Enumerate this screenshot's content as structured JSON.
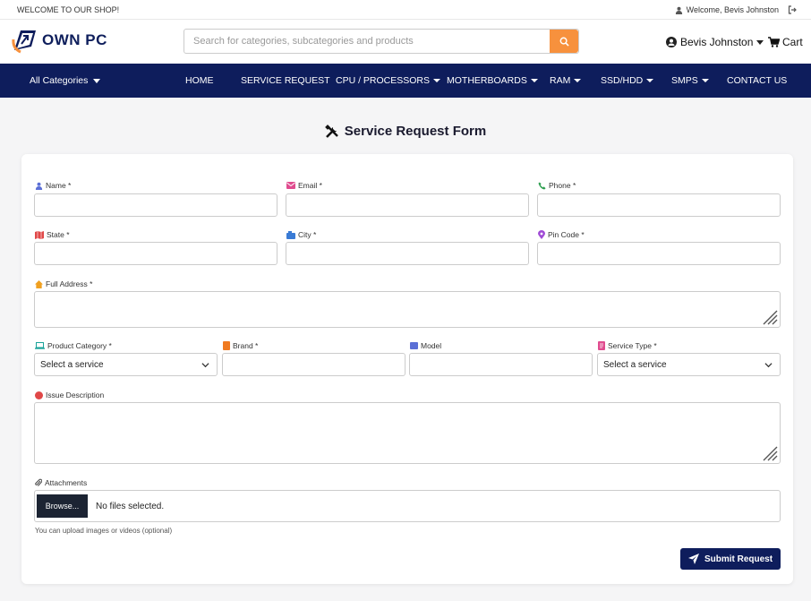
{
  "topbar": {
    "welcome": "WELCOME TO OUR SHOP!",
    "greeting": "Welcome, Bevis Johnston"
  },
  "header": {
    "logo_text": "OWN PC",
    "search_placeholder": "Search for categories, subcategories and products",
    "user_name": "Bevis Johnston",
    "cart_label": "Cart"
  },
  "nav": {
    "all_categories": "All Categories",
    "items": [
      "HOME",
      "SERVICE REQUEST",
      "CPU / PROCESSORS",
      "MOTHERBOARDS",
      "RAM",
      "SSD/HDD",
      "SMPS",
      "CONTACT US"
    ]
  },
  "form": {
    "title": "Service Request Form",
    "labels": {
      "name": "Name *",
      "email": "Email *",
      "phone": "Phone *",
      "state": "State *",
      "city": "City *",
      "pincode": "Pin Code *",
      "address": "Full Address *",
      "category": "Product Category *",
      "brand": "Brand *",
      "model": "Model",
      "service_type": "Service Type *",
      "issue": "Issue Description",
      "attachments": "Attachments"
    },
    "category_value": "Select a service",
    "service_type_value": "Select a service",
    "browse_label": "Browse...",
    "no_files": "No files selected.",
    "help_text": "You can upload images or videos (optional)",
    "submit_label": "Submit Request"
  },
  "colors": {
    "navy": "#0e1d5c",
    "orange": "#f7913d"
  }
}
